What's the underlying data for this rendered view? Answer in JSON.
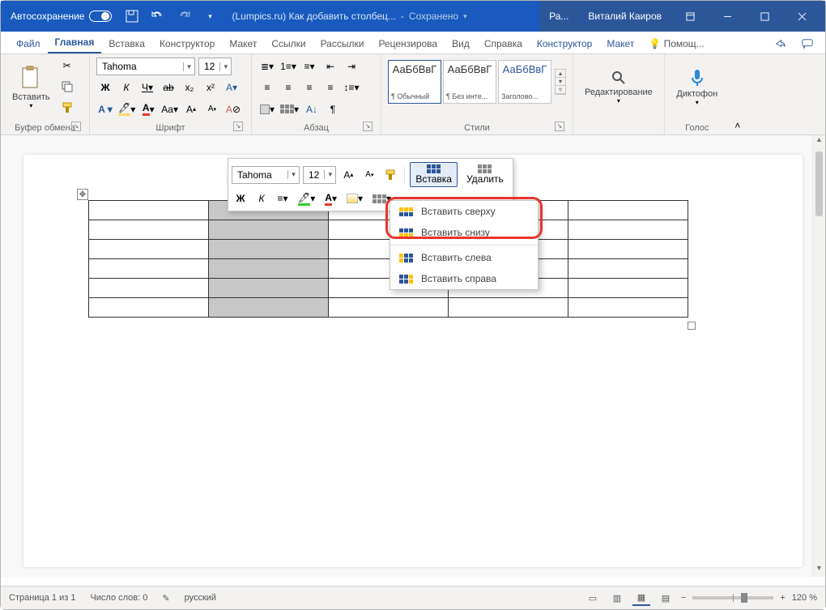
{
  "titlebar": {
    "autosave": "Автосохранение",
    "docname": "(Lumpics.ru) Как добавить столбец...",
    "saved": "Сохранено",
    "tab_short": "Ра...",
    "user": "Виталий Каиров"
  },
  "tabs": {
    "file": "Файл",
    "home": "Главная",
    "insert": "Вставка",
    "design": "Конструктор",
    "layout": "Макет",
    "references": "Ссылки",
    "mailings": "Рассылки",
    "review": "Рецензирова",
    "view": "Вид",
    "help": "Справка",
    "ctx_design": "Конструктор",
    "ctx_layout": "Макет",
    "tellme": "Помощ..."
  },
  "ribbon": {
    "clipboard": {
      "paste": "Вставить",
      "group": "Буфер обмена"
    },
    "font": {
      "family": "Tahoma",
      "size": "12",
      "group": "Шрифт",
      "bold": "Ж",
      "italic": "К",
      "underline": "Ч",
      "strike": "ab",
      "sub": "x₂",
      "sup": "x²"
    },
    "paragraph": {
      "group": "Абзац"
    },
    "styles": {
      "group": "Стили",
      "items": [
        {
          "preview": "АаБбВвГ",
          "name": "¶ Обычный"
        },
        {
          "preview": "АаБбВвГ",
          "name": "¶ Без инте..."
        },
        {
          "preview": "АаБбВвГ",
          "name": "Заголово..."
        }
      ]
    },
    "editing": {
      "label": "Редактирование"
    },
    "voice": {
      "label": "Диктофон",
      "group": "Голос"
    }
  },
  "minitoolbar": {
    "font": "Tahoma",
    "size": "12",
    "bold": "Ж",
    "italic": "К",
    "insert": "Вставка",
    "delete": "Удалить"
  },
  "dropdown": {
    "above": "Вставить сверху",
    "below": "Вставить снизу",
    "left": "Вставить слева",
    "right": "Вставить справа"
  },
  "statusbar": {
    "page": "Страница 1 из 1",
    "words": "Число слов: 0",
    "lang": "русский",
    "zoom": "120 %"
  }
}
